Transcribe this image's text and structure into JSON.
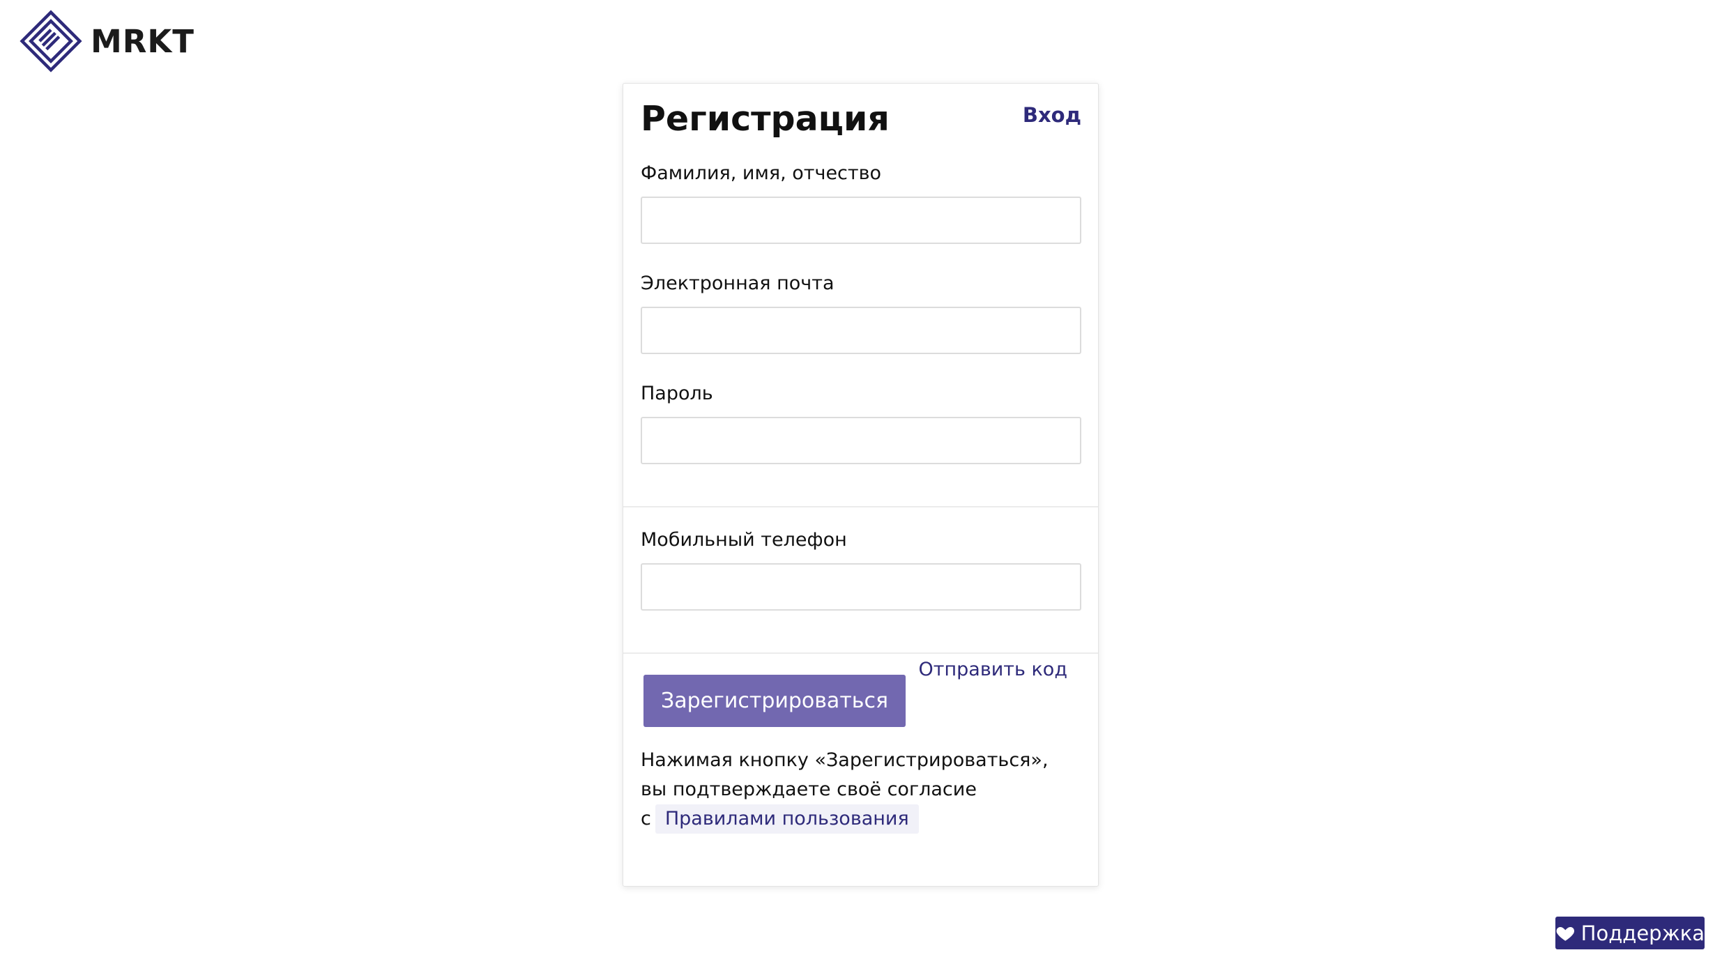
{
  "brand": {
    "name": "MRKT",
    "accent_color": "#2e2a7a",
    "button_color": "#7268b0",
    "logo_icon": "diamond-stripes-logo"
  },
  "form": {
    "title": "Регистрация",
    "login_link": "Вход",
    "full_name": {
      "label": "Фамилия, имя, отчество",
      "value": ""
    },
    "email": {
      "label": "Электронная почта",
      "value": ""
    },
    "password": {
      "label": "Пароль",
      "value": ""
    },
    "phone": {
      "label": "Мобильный телефон",
      "value": "",
      "send_code_label": "Отправить код"
    },
    "submit_label": "Зарегистрироваться",
    "consent": {
      "line1": "Нажимая кнопку «Зарегистрироваться»,",
      "line2": "вы подтверждаете своё согласие",
      "prefix": "с",
      "rules_link": "Правилами пользования"
    }
  },
  "support": {
    "label": "Поддержка",
    "icon": "heart-icon"
  }
}
